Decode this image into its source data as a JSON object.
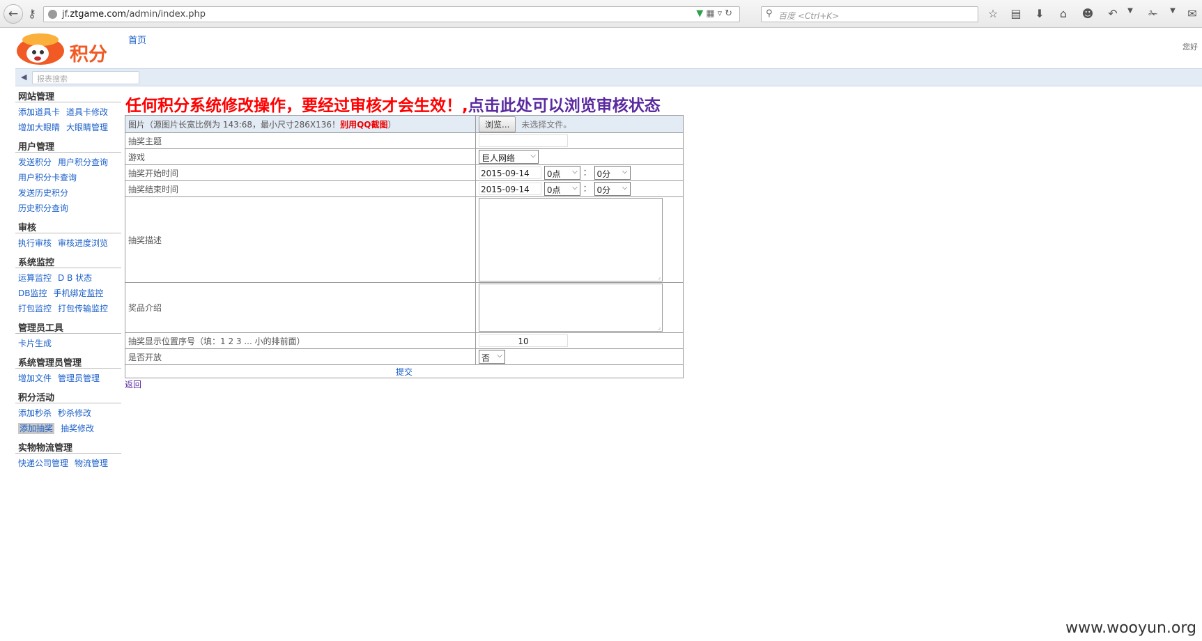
{
  "browser": {
    "url_prefix": "jf.",
    "url_domain": "ztgame.com",
    "url_path": "/admin/index.php",
    "search_placeholder": "百度 <Ctrl+K>"
  },
  "header": {
    "home_link": "首页",
    "greeting": "您好",
    "search_placeholder": "报表搜索"
  },
  "sidebar": {
    "groups": [
      {
        "title": "网站管理",
        "rows": [
          [
            "添加道具卡",
            "道具卡修改"
          ],
          [
            "增加大眼睛",
            "大眼睛管理"
          ]
        ]
      },
      {
        "title": "用户管理",
        "rows": [
          [
            "发送积分",
            "用户积分查询"
          ],
          [
            "用户积分卡查询"
          ],
          [
            "发送历史积分"
          ],
          [
            "历史积分查询"
          ]
        ]
      },
      {
        "title": "审核",
        "rows": [
          [
            "执行审核",
            "审核进度浏览"
          ]
        ]
      },
      {
        "title": "系统监控",
        "rows": [
          [
            "运算监控",
            "D B 状态"
          ],
          [
            "DB监控",
            "手机绑定监控"
          ],
          [
            "打包监控",
            "打包传输监控"
          ]
        ]
      },
      {
        "title": "管理员工具",
        "rows": [
          [
            "卡片生成"
          ]
        ]
      },
      {
        "title": "系统管理员管理",
        "rows": [
          [
            "增加文件",
            "管理员管理"
          ]
        ]
      },
      {
        "title": "积分活动",
        "rows": [
          [
            "添加秒杀",
            "秒杀修改"
          ],
          [
            "添加抽奖",
            "抽奖修改"
          ]
        ]
      },
      {
        "title": "实物物流管理",
        "rows": [
          [
            "快递公司管理",
            "物流管理"
          ]
        ]
      }
    ],
    "active": "添加抽奖"
  },
  "notice": {
    "red": "任何积分系统修改操作，要经过审核才会生效！,",
    "purple": "点击此处可以浏览审核状态"
  },
  "form": {
    "image_label": "图片（源图片长宽比例为 143:68，最小尺寸286X136！",
    "image_label_red": "别用QQ截图",
    "image_label_end": "）",
    "browse_button": "浏览...",
    "no_file": "未选择文件。",
    "subject_label": "抽奖主题",
    "subject_value": "",
    "game_label": "游戏",
    "game_value": "巨人网络",
    "start_label": "抽奖开始时间",
    "start_date": "2015-09-14",
    "start_hour": "0点",
    "start_min": "0分",
    "end_label": "抽奖结束时间",
    "end_date": "2015-09-14",
    "end_hour": "0点",
    "end_min": "0分",
    "colon": "：",
    "desc_label": "抽奖描述",
    "prize_label": "奖品介绍",
    "order_label": "抽奖显示位置序号（填：1 2 3 ... 小的排前面）",
    "order_value": "10",
    "open_label": "是否开放",
    "open_value": "否",
    "submit": "提交",
    "back": "返回"
  },
  "watermark": "www.wooyun.org"
}
